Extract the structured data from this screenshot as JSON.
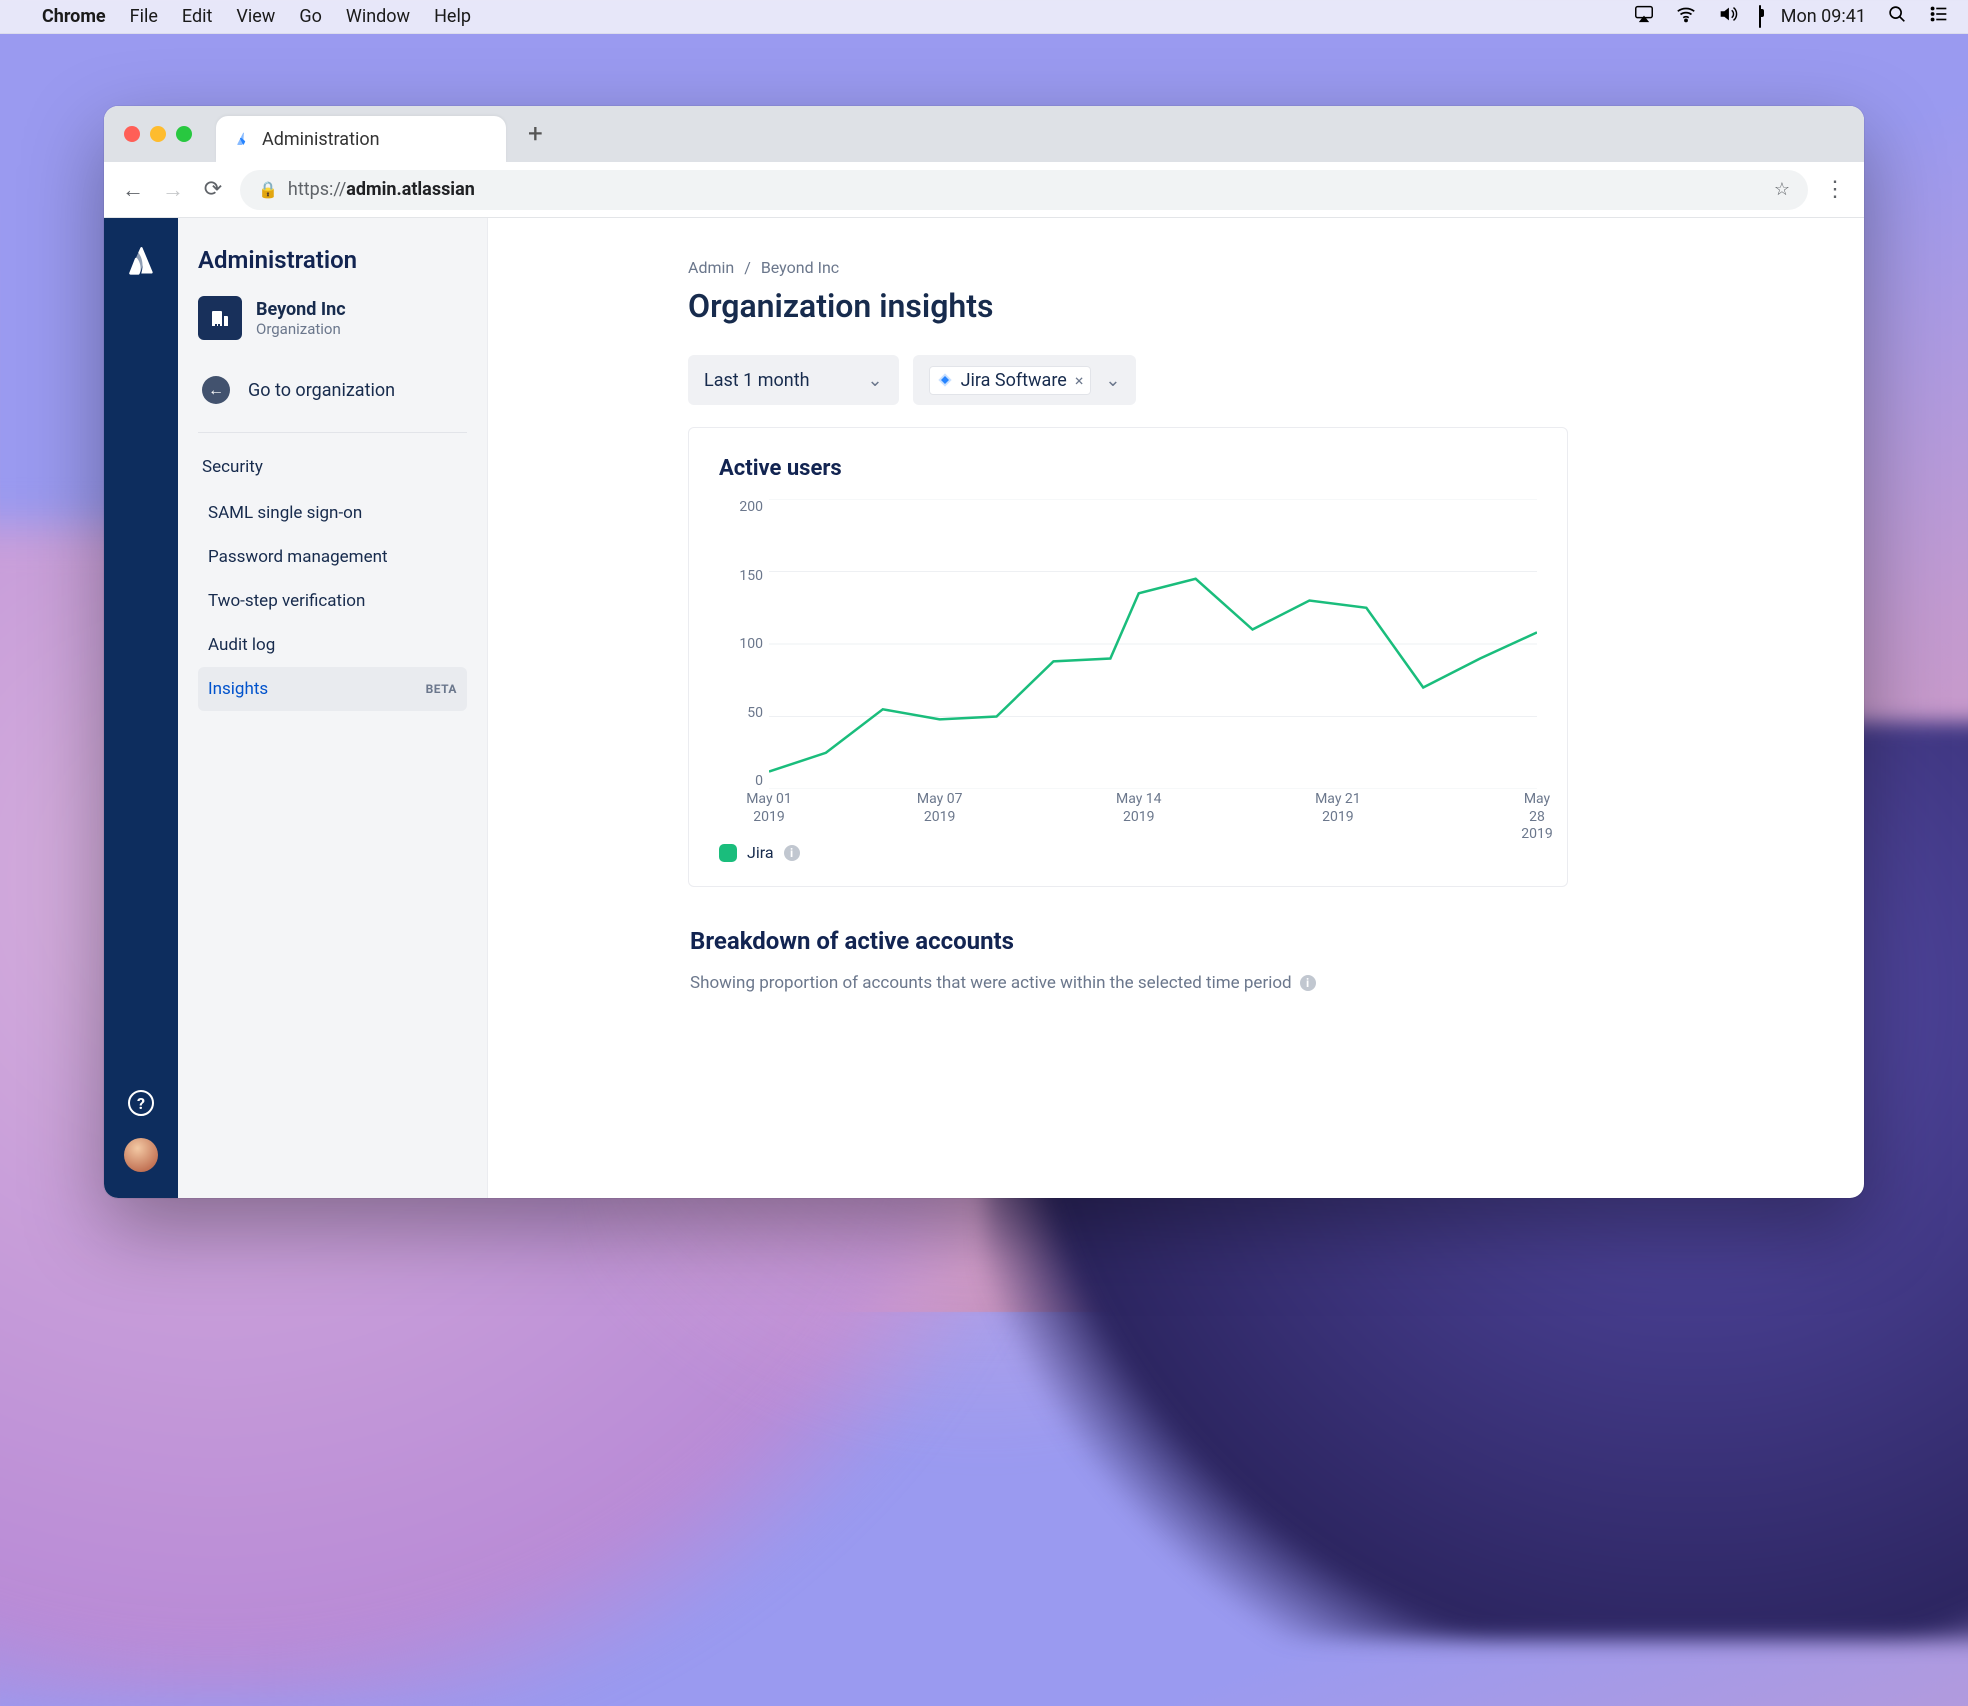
{
  "menubar": {
    "app": "Chrome",
    "items": [
      "File",
      "Edit",
      "View",
      "Go",
      "Window",
      "Help"
    ],
    "clock": "Mon 09:41"
  },
  "browser": {
    "tab_title": "Administration",
    "url_prefix": "https://",
    "url_host": "admin.atlassian"
  },
  "sidebar": {
    "heading": "Administration",
    "org_name": "Beyond Inc",
    "org_sub": "Organization",
    "goto": "Go to organization",
    "section": "Security",
    "items": [
      {
        "label": "SAML single sign-on"
      },
      {
        "label": "Password management"
      },
      {
        "label": "Two-step verification"
      },
      {
        "label": "Audit log"
      },
      {
        "label": "Insights",
        "badge": "BETA",
        "active": true
      }
    ]
  },
  "page": {
    "crumbs": [
      "Admin",
      "Beyond Inc"
    ],
    "title": "Organization insights",
    "filter_range": "Last 1 month",
    "filter_product": "Jira Software"
  },
  "card1": {
    "title": "Active users",
    "legend": "Jira"
  },
  "card2": {
    "title": "Breakdown of active accounts",
    "desc": "Showing proportion of accounts that were active within the selected time period"
  },
  "chart_data": {
    "type": "line",
    "title": "Active users",
    "xlabel": "",
    "ylabel": "",
    "ylim": [
      0,
      200
    ],
    "y_ticks": [
      0,
      50,
      100,
      150,
      200
    ],
    "x_tick_labels": [
      "May 01\n2019",
      "May 07\n2019",
      "May 14\n2019",
      "May 21\n2019",
      "May 28\n2019"
    ],
    "x_tick_positions": [
      1,
      7,
      14,
      21,
      28
    ],
    "series": [
      {
        "name": "Jira",
        "color": "#1abd7c",
        "x": [
          1,
          3,
          5,
          7,
          9,
          11,
          13,
          14,
          16,
          18,
          20,
          22,
          24,
          26,
          28
        ],
        "values": [
          12,
          25,
          55,
          48,
          50,
          88,
          90,
          135,
          145,
          110,
          130,
          125,
          70,
          90,
          108
        ]
      }
    ]
  }
}
